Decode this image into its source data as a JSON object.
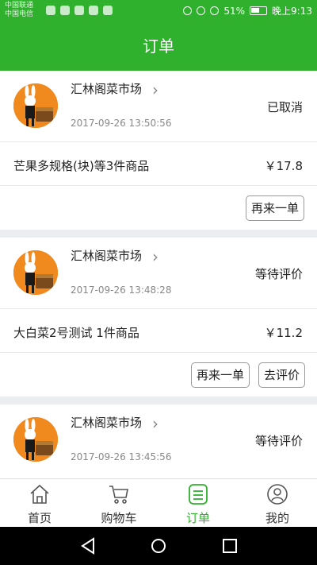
{
  "statusbar": {
    "carrier_1": "中国联通",
    "carrier_2": "中国电信",
    "battery": "51%",
    "time": "晚上9:13"
  },
  "header": {
    "title": "订单"
  },
  "orders": [
    {
      "store": "汇林阁菜市场",
      "status": "已取消",
      "time": "2017-09-26 13:50:56",
      "goods": "芒果多规格(块)等3件商品",
      "price": "￥17.8",
      "buttons": [
        "再来一单"
      ]
    },
    {
      "store": "汇林阁菜市场",
      "status": "等待评价",
      "time": "2017-09-26 13:48:28",
      "goods": "大白菜2号测试 1件商品",
      "price": "￥11.2",
      "buttons": [
        "再来一单",
        "去评价"
      ]
    },
    {
      "store": "汇林阁菜市场",
      "status": "等待评价",
      "time": "2017-09-26 13:45:56"
    }
  ],
  "tabs": [
    {
      "label": "首页",
      "icon": "home-icon"
    },
    {
      "label": "购物车",
      "icon": "cart-icon"
    },
    {
      "label": "订单",
      "icon": "order-list-icon"
    },
    {
      "label": "我的",
      "icon": "user-icon"
    }
  ],
  "colors": {
    "accent": "#2fb12d",
    "background": "#ebeef0",
    "avatar": "#f08a1e"
  }
}
